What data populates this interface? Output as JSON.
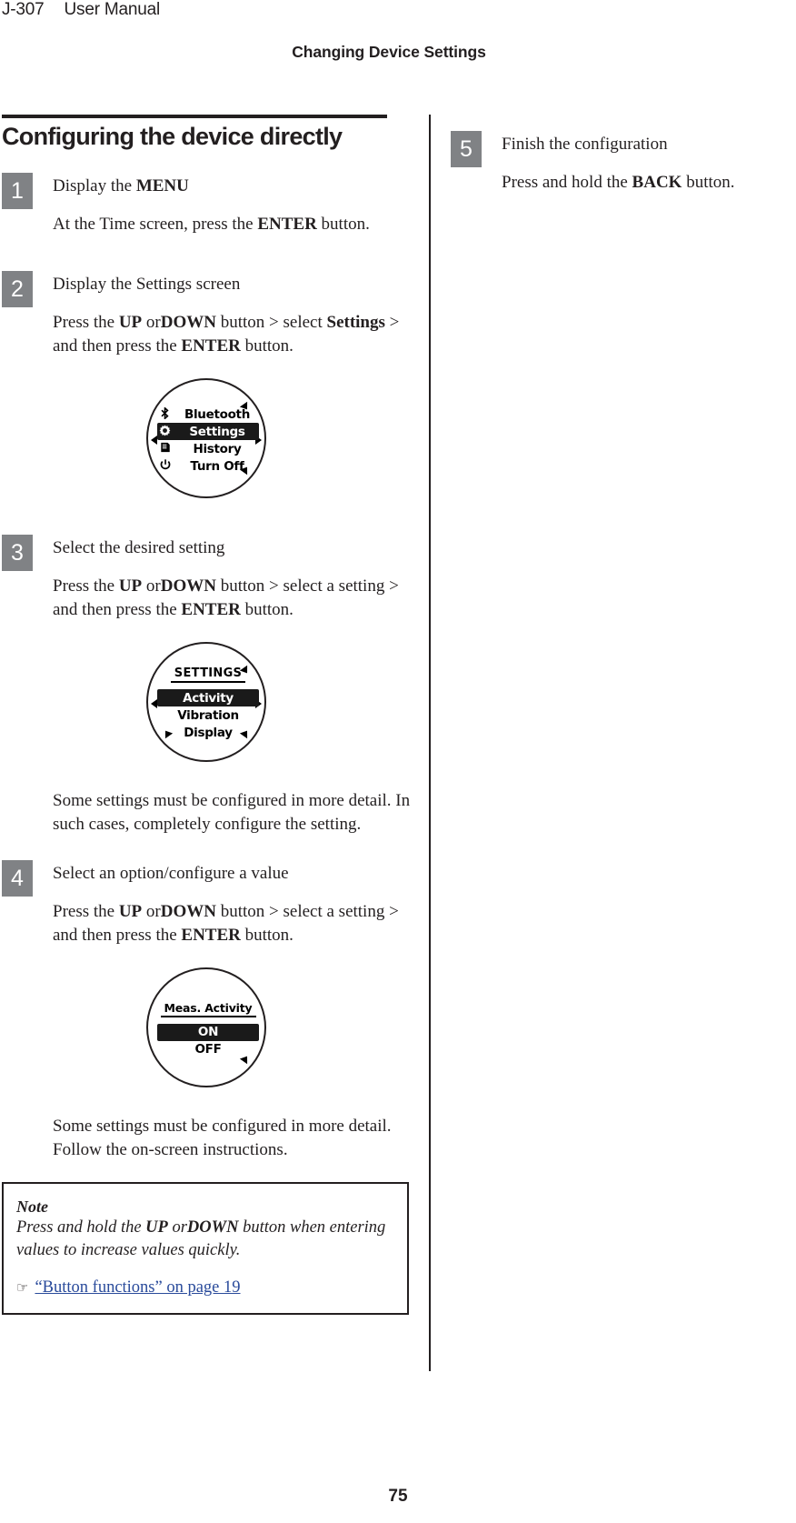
{
  "header": {
    "doc_id": "J-307",
    "doc_type": "User Manual",
    "chapter": "Changing Device Settings"
  },
  "section": {
    "title": "Configuring the device directly"
  },
  "steps": [
    {
      "number": "1",
      "title_prefix": "Display the ",
      "title_bold": "MENU",
      "title_suffix": "",
      "text_parts": [
        "At the Time screen, press the ",
        "ENTER",
        " button."
      ]
    },
    {
      "number": "2",
      "title_prefix": "Display the Settings screen",
      "title_bold": "",
      "title_suffix": "",
      "text_parts": [
        "Press the ",
        "UP",
        " or",
        "DOWN",
        " button > select ",
        "Settings",
        " > and then press the ",
        "ENTER",
        " button."
      ]
    },
    {
      "number": "3",
      "title_prefix": "Select the desired setting",
      "title_bold": "",
      "title_suffix": "",
      "text_parts": [
        "Press the ",
        "UP",
        " or",
        "DOWN",
        " button > select a setting > and then press the ",
        "ENTER",
        " button."
      ],
      "note_after": "Some settings must be configured in more detail. In such cases, completely configure the setting."
    },
    {
      "number": "4",
      "title_prefix": "Select an option/configure a value",
      "title_bold": "",
      "title_suffix": "",
      "text_parts": [
        "Press the ",
        "UP",
        " or",
        "DOWN",
        " button > select a setting > and then press the ",
        "ENTER",
        " button."
      ],
      "note_after": "Some settings must be configured in more detail. Follow the on-screen instructions."
    },
    {
      "number": "5",
      "title_prefix": "Finish the configuration",
      "title_bold": "",
      "title_suffix": "",
      "text_parts": [
        "Press and hold the ",
        "BACK",
        " button."
      ]
    }
  ],
  "step_labels": {
    "press_the": "Press the ",
    "up": "UP",
    "or": " or",
    "down": "DOWN",
    "button_select_settings": " button > select ",
    "settings_bold": "Settings",
    "and_then_press": " > and then press the ",
    "enter": "ENTER",
    "button_period": " button.",
    "button_select_a_setting": " button > select a setting",
    "at_time_screen": "At the Time screen, press the ",
    "press_and_hold": "Press and hold the ",
    "back": "BACK",
    "display_the": "Display the ",
    "menu": "MENU",
    "display_settings_screen": "Display the Settings screen",
    "select_desired_setting": "Select the desired setting",
    "select_option": "Select an option/configure a value",
    "finish_config": "Finish the configuration",
    "detail_note_3": "Some settings must be configured in more detail. In such cases, completely configure the setting.",
    "detail_note_4": "Some settings must be configured in more detail. Follow the on-screen instructions."
  },
  "watch_menu": {
    "header": "",
    "items": [
      {
        "icon": "bluetooth-icon",
        "glyph": "␣",
        "label": "Bluetooth",
        "selected": false
      },
      {
        "icon": "gear-icon",
        "glyph": "⚙",
        "label": "Settings",
        "selected": true
      },
      {
        "icon": "history-list-icon",
        "glyph": "☰",
        "label": "History",
        "selected": false
      },
      {
        "icon": "power-icon",
        "glyph": "⏻",
        "label": "Turn Off",
        "selected": false
      }
    ]
  },
  "watch_settings": {
    "header": "SETTINGS",
    "items": [
      {
        "label": "Activity",
        "selected": true
      },
      {
        "label": "Vibration",
        "selected": false
      },
      {
        "label": "Display",
        "selected": false
      }
    ]
  },
  "watch_activity": {
    "header": "Meas. Activity",
    "items": [
      {
        "label": "ON",
        "selected": true
      },
      {
        "label": "OFF",
        "selected": false
      }
    ]
  },
  "note": {
    "title": "Note",
    "body_parts": [
      "Press and hold the ",
      "UP",
      " or",
      "DOWN",
      " button when entering values to increase values quickly."
    ],
    "body_text": "Press and hold the UP orDOWN button when entering values to increase values quickly.",
    "link_glyph": "☞",
    "link_text": "“Button functions” on page 19",
    "link_color": "#2a4b9b"
  },
  "footer": {
    "page_number": "75"
  },
  "colors": {
    "badge_gray": "#808285",
    "ink": "#231f20",
    "link": "#2a4b9b"
  }
}
